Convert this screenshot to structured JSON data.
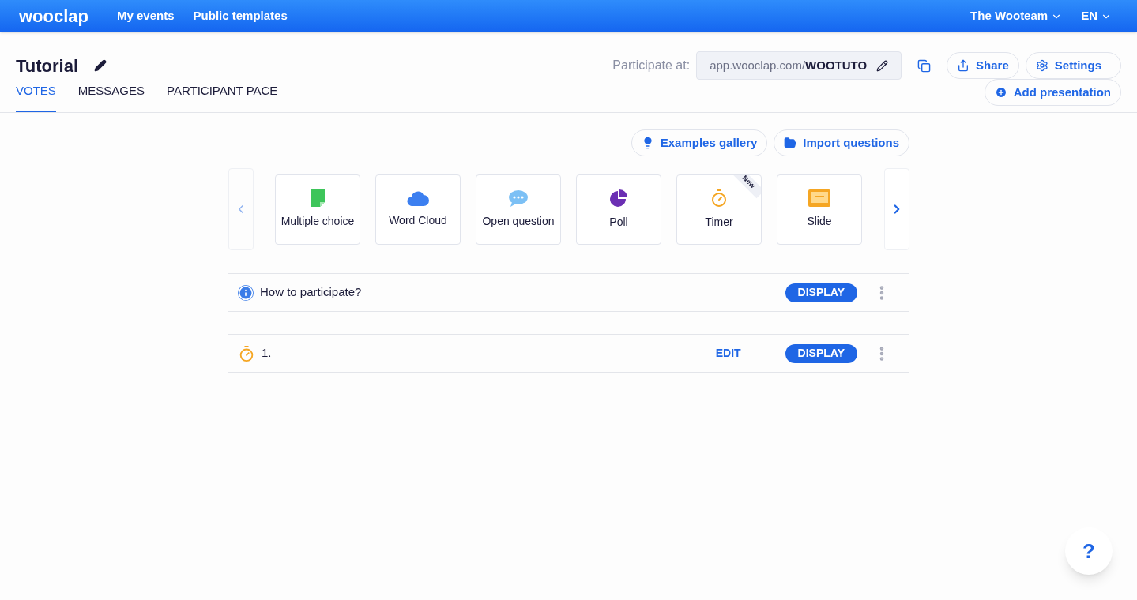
{
  "topbar": {
    "logo": "wooclap",
    "links": [
      "My events",
      "Public templates"
    ],
    "team": "The Wooteam",
    "language": "EN"
  },
  "event": {
    "title": "Tutorial",
    "participate_label": "Participate at:",
    "url_prefix": "app.wooclap.com/",
    "url_code": "WOOTUTO",
    "share": "Share",
    "settings": "Settings"
  },
  "tabs": [
    {
      "label": "VOTES",
      "selected": true
    },
    {
      "label": "MESSAGES",
      "selected": false
    },
    {
      "label": "PARTICIPANT PACE",
      "selected": false
    }
  ],
  "add_presentation": "Add presentation",
  "actions": [
    "Examples gallery",
    "Import questions"
  ],
  "question_types": [
    {
      "kind": "multiple",
      "label": "Multiple choice"
    },
    {
      "kind": "cloud",
      "label": "Word Cloud"
    },
    {
      "kind": "open",
      "label": "Open question"
    },
    {
      "kind": "poll",
      "label": "Poll"
    },
    {
      "kind": "timer",
      "label": "Timer",
      "badge": "New"
    },
    {
      "kind": "slide",
      "label": "Slide"
    }
  ],
  "questions": [
    {
      "kind": "info",
      "title": "How to participate?",
      "display": "DISPLAY"
    },
    {
      "kind": "timer",
      "title": "1.",
      "edit": "EDIT",
      "display": "DISPLAY"
    }
  ],
  "help": "?"
}
